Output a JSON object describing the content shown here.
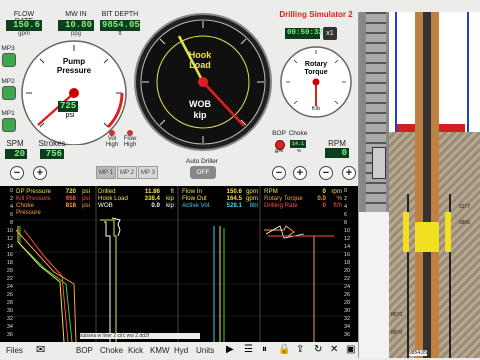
{
  "top": {
    "flow_rate": {
      "label": "FLOW RATE",
      "value": "150.6",
      "unit": "gpm"
    },
    "mw_in": {
      "label": "MW IN",
      "value": "10.80",
      "unit": "ppg"
    },
    "bit_depth": {
      "label": "BIT DEPTH",
      "value": "9854.05",
      "unit": "ft"
    },
    "title": "Drilling Simulator 2",
    "clock": "00:50:32",
    "speed": "x1"
  },
  "pump_gauge": {
    "title_line1": "Pump",
    "title_line2": "Pressure",
    "value": "725",
    "unit": "psi"
  },
  "mp_buttons": [
    "MP3",
    "MP2",
    "MP1"
  ],
  "hook_gauge": {
    "top_label_1": "Hook",
    "top_label_2": "Load",
    "bottom_label_1": "WOB",
    "bottom_label_2": "kip"
  },
  "rotary_gauge": {
    "title_line1": "Rotary",
    "title_line2": "Torque",
    "unit": "ft.lb"
  },
  "spm": {
    "label": "SPM",
    "value": "20"
  },
  "strokes": {
    "label": "Strokes",
    "value": "756"
  },
  "vol_high": {
    "line1": "Vol",
    "line2": "High"
  },
  "flow_high": {
    "line1": "Flow",
    "line2": "High"
  },
  "bop": {
    "label": "BOP",
    "sub": "gpm"
  },
  "choke": {
    "label": "Choke",
    "value": "14.1",
    "sub": "%"
  },
  "rpm": {
    "label": "RPM",
    "value": "0"
  },
  "mp_tabs": [
    "MP 1",
    "MP 2",
    "MP 3"
  ],
  "auto_driller": {
    "label": "Auto Driller",
    "state": "OFF"
  },
  "readouts": {
    "p1": [
      {
        "name": "DP Pressure",
        "value": "720",
        "unit": "psi",
        "color": "#f0e04a"
      },
      {
        "name": "Kill Pressure",
        "value": "958",
        "unit": "psi",
        "color": "#ff4d4d"
      },
      {
        "name": "Choke Pressure",
        "value": "818",
        "unit": "psi",
        "color": "#ffa040"
      }
    ],
    "p2": [
      {
        "name": "Drilled",
        "value": "11.86",
        "unit": "ft",
        "color": "#f0e04a"
      },
      {
        "name": "Hook Load",
        "value": "338.4",
        "unit": "kip",
        "color": "#f0e04a"
      },
      {
        "name": "WOB",
        "value": "0.0",
        "unit": "kip",
        "color": "#ffffff"
      }
    ],
    "p3": [
      {
        "name": "Flow In",
        "value": "150.6",
        "unit": "gpm",
        "color": "#f0e04a"
      },
      {
        "name": "Flow Out",
        "value": "164.5",
        "unit": "gpm",
        "color": "#f0e04a"
      },
      {
        "name": "Active Vol.",
        "value": "528.1",
        "unit": "bbl",
        "color": "#40d0f0"
      }
    ],
    "p4": [
      {
        "name": "RPM",
        "value": "0",
        "unit": "rpm",
        "color": "#f0e04a"
      },
      {
        "name": "Rotary Torque",
        "value": "0.0",
        "unit": "%",
        "color": "#f0a040"
      },
      {
        "name": "Drilling Rate",
        "value": "0",
        "unit": "ft/h",
        "color": "#ff4d4d"
      }
    ]
  },
  "time_ticks": [
    "0",
    "2",
    "4",
    "6",
    "8",
    "10",
    "12",
    "14",
    "16",
    "18",
    "20",
    "22",
    "24",
    "26",
    "28",
    "30",
    "32",
    "34",
    "36"
  ],
  "well_label": "subsea w liner 2 circ ww 2.dd2f",
  "wellbore_depths": {
    "d1": "5377",
    "d2": "5806",
    "d3": "8670",
    "d4": "8870",
    "d5": "9854.05"
  },
  "toolbar": [
    "Files",
    "BOP",
    "Choke",
    "Kick",
    "KMW",
    "Hyd",
    "Units"
  ]
}
